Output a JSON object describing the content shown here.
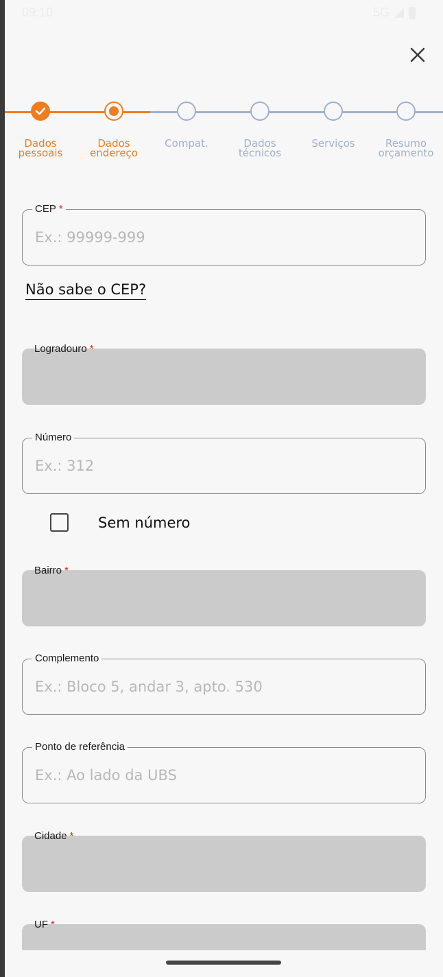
{
  "status": {
    "time": "09:10",
    "network": "5G"
  },
  "close_icon": "close-icon",
  "stepper": {
    "steps": [
      {
        "label_1": "Dados",
        "label_2": "pessoais",
        "state": "done"
      },
      {
        "label_1": "Dados",
        "label_2": "endereço",
        "state": "active"
      },
      {
        "label_1": "Compat.",
        "label_2": "",
        "state": "pending"
      },
      {
        "label_1": "Dados",
        "label_2": "técnicos",
        "state": "pending"
      },
      {
        "label_1": "Serviços",
        "label_2": "",
        "state": "pending"
      },
      {
        "label_1": "Resumo",
        "label_2": "orçamento",
        "state": "pending"
      }
    ],
    "accent_color": "#f07c1e",
    "pending_color": "#9fb0cc"
  },
  "form": {
    "cep": {
      "label": "CEP",
      "required": "*",
      "placeholder": "Ex.: 99999-999"
    },
    "cep_link": "Não sabe o CEP?",
    "logradouro": {
      "label": "Logradouro",
      "required": "*"
    },
    "numero": {
      "label": "Número",
      "placeholder": "Ex.: 312"
    },
    "sem_numero": "Sem número",
    "bairro": {
      "label": "Bairro",
      "required": "*"
    },
    "complemento": {
      "label": "Complemento",
      "placeholder": "Ex.: Bloco 5, andar 3, apto. 530"
    },
    "referencia": {
      "label": "Ponto de referência",
      "placeholder": "Ex.: Ao lado da UBS"
    },
    "cidade": {
      "label": "Cidade",
      "required": "*"
    },
    "uf": {
      "label": "UF",
      "required": "*"
    }
  }
}
